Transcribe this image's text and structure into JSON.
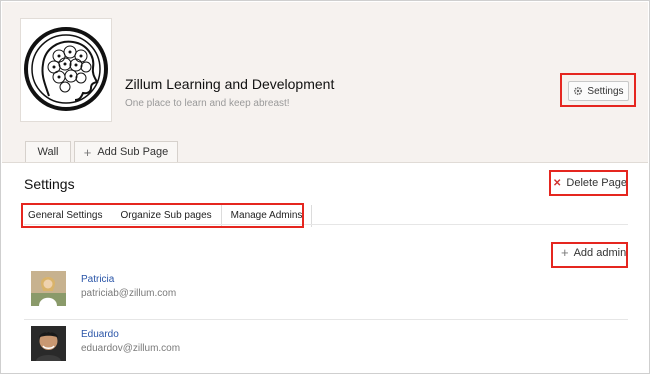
{
  "header": {
    "org_name": "Zillum Learning and Development",
    "tagline": "One place to learn and keep abreast!",
    "settings_label": "Settings"
  },
  "tabs": {
    "wall": "Wall",
    "add_sub_page": "Add Sub Page"
  },
  "section": {
    "title": "Settings",
    "delete_label": "Delete Page"
  },
  "subtabs": [
    {
      "label": "General Settings"
    },
    {
      "label": "Organize Sub pages"
    },
    {
      "label": "Manage Admins",
      "active": true
    }
  ],
  "add_admin_label": "Add admin",
  "admins": [
    {
      "name": "Patricia",
      "email": "patriciab@zillum.com"
    },
    {
      "name": "Eduardo",
      "email": "eduardov@zillum.com"
    }
  ],
  "colors": {
    "highlight": "#e5261f",
    "link": "#2a55a8",
    "header_bg": "#f6f2ef"
  }
}
